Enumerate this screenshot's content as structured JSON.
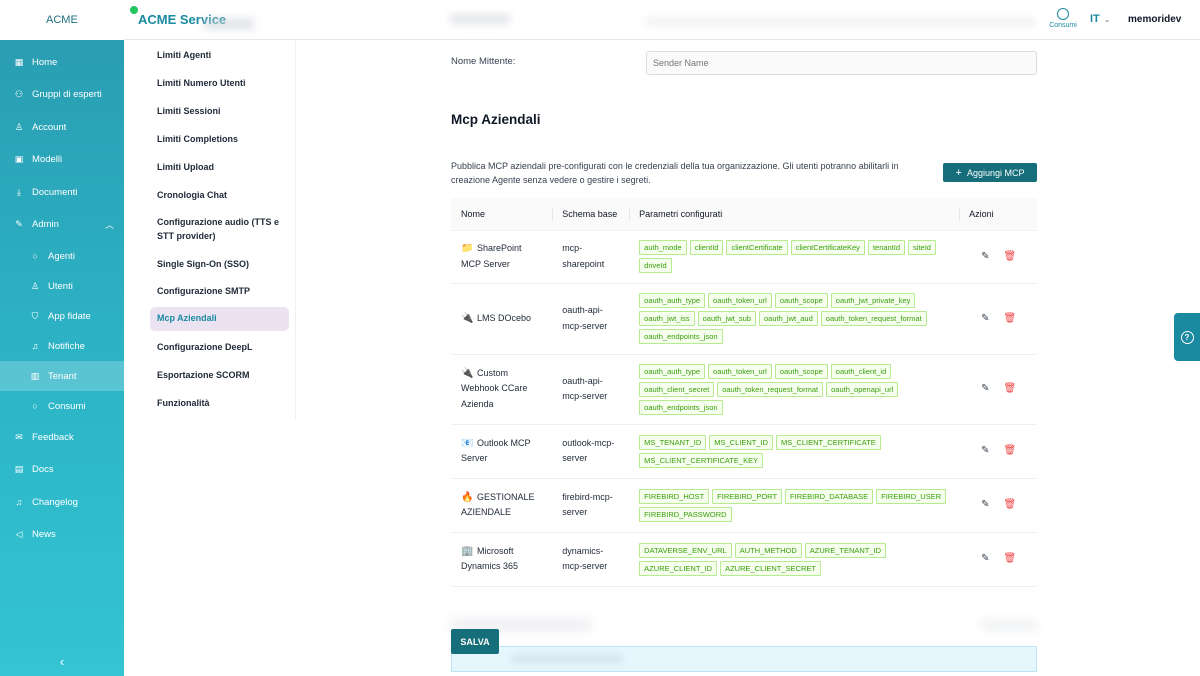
{
  "sidebar": {
    "brand": "ACME",
    "items": [
      {
        "label": "Home",
        "icon": "grid-icon"
      },
      {
        "label": "Gruppi di esperti",
        "icon": "users-icon"
      },
      {
        "label": "Account",
        "icon": "user-icon"
      },
      {
        "label": "Modelli",
        "icon": "model-icon"
      },
      {
        "label": "Documenti",
        "icon": "upload-icon"
      },
      {
        "label": "Admin",
        "icon": "wrench-icon"
      }
    ],
    "admin_subitems": [
      {
        "label": "Agenti",
        "icon": "circle-icon"
      },
      {
        "label": "Utenti",
        "icon": "user-icon"
      },
      {
        "label": "App fidate",
        "icon": "shield-icon"
      },
      {
        "label": "Notifiche",
        "icon": "bell-icon"
      },
      {
        "label": "Tenant",
        "icon": "building-icon",
        "active": true
      },
      {
        "label": "Consumi",
        "icon": "circle-icon"
      }
    ],
    "bottom_items": [
      {
        "label": "Feedback",
        "icon": "feedback-icon"
      },
      {
        "label": "Docs",
        "icon": "doc-icon"
      },
      {
        "label": "Changelog",
        "icon": "bell-icon"
      },
      {
        "label": "News",
        "icon": "megaphone-icon"
      }
    ],
    "collapse_symbol": "‹"
  },
  "topbar": {
    "title": "ACME Service",
    "consumi_label": "Consumi",
    "language": "IT",
    "username": "memoridev"
  },
  "submenu": {
    "items": [
      "Limiti Agenti",
      "Limiti Numero Utenti",
      "Limiti Sessioni",
      "Limiti Completions",
      "Limiti Upload",
      "Cronologia Chat",
      "Configurazione audio (TTS e STT provider)",
      "Single Sign-On (SSO)",
      "Configurazione SMTP",
      "Mcp Aziendali",
      "Configurazione DeepL",
      "Esportazione SCORM",
      "Funzionalità"
    ],
    "active": "Mcp Aziendali"
  },
  "main": {
    "sender_label": "Nome Mittente:",
    "sender_placeholder": "Sender Name",
    "section_title": "Mcp Aziendali",
    "description": "Pubblica MCP aziendali pre-configurati con le credenziali della tua organizzazione. Gli utenti potranno abilitarli in creazione Agente senza vedere o gestire i segreti.",
    "add_button": "Aggiungi MCP",
    "table": {
      "headers": [
        "Nome",
        "Schema base",
        "Parametri configurati",
        "Azioni"
      ],
      "rows": [
        {
          "icon": "📁",
          "name": "SharePoint MCP Server",
          "schema": "mcp-sharepoint",
          "params": [
            "auth_mode",
            "clientId",
            "clientCertificate",
            "clientCertificateKey",
            "tenantId",
            "siteId",
            "driveId"
          ]
        },
        {
          "icon": "🔌",
          "name": "LMS DOcebo",
          "schema": "oauth-api-mcp-server",
          "params": [
            "oauth_auth_type",
            "oauth_token_url",
            "oauth_scope",
            "oauth_jwt_private_key",
            "oauth_jwt_iss",
            "oauth_jwt_sub",
            "oauth_jwt_aud",
            "oauth_token_request_format",
            "oauth_endpoints_json"
          ]
        },
        {
          "icon": "🔌",
          "name": "Custom Webhook CCare Azienda",
          "schema": "oauth-api-mcp-server",
          "params": [
            "oauth_auth_type",
            "oauth_token_url",
            "oauth_scope",
            "oauth_client_id",
            "oauth_client_secret",
            "oauth_token_request_format",
            "oauth_openapi_url",
            "oauth_endpoints_json"
          ]
        },
        {
          "icon": "📧",
          "name": "Outlook MCP Server",
          "schema": "outlook-mcp-server",
          "params": [
            "MS_TENANT_ID",
            "MS_CLIENT_ID",
            "MS_CLIENT_CERTIFICATE",
            "MS_CLIENT_CERTIFICATE_KEY"
          ]
        },
        {
          "icon": "🔥",
          "name": "GESTIONALE AZIENDALE",
          "schema": "firebird-mcp-server",
          "params": [
            "FIREBIRD_HOST",
            "FIREBIRD_PORT",
            "FIREBIRD_DATABASE",
            "FIREBIRD_USER",
            "FIREBIRD_PASSWORD"
          ]
        },
        {
          "icon": "🏢",
          "name": "Microsoft Dynamics 365",
          "schema": "dynamics-mcp-server",
          "params": [
            "DATAVERSE_ENV_URL",
            "AUTH_METHOD",
            "AZURE_TENANT_ID",
            "AZURE_CLIENT_ID",
            "AZURE_CLIENT_SECRET"
          ]
        }
      ],
      "edit_symbol": "✎",
      "delete_symbol": "🗑"
    },
    "save_button": "SALVA"
  },
  "colors": {
    "accent": "#1a8aa0",
    "button": "#166e7a",
    "tag_text": "#389e0d",
    "tag_border": "#b7eb8f",
    "tag_bg": "#f6ffed",
    "delete": "#ef4444",
    "active_submenu_bg": "#ece3f2"
  }
}
